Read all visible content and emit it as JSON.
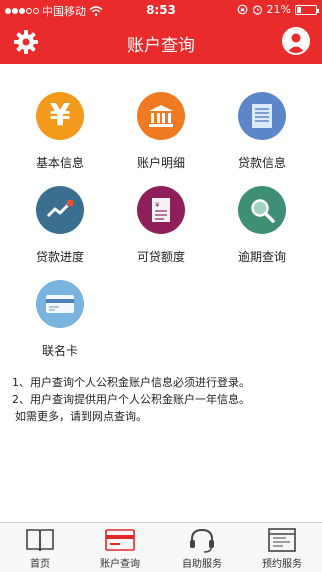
{
  "status_bar": {
    "carrier": "中国移动",
    "time": "8:53",
    "battery": "21%"
  },
  "header": {
    "title": "账户查询",
    "settings_icon": "gear-icon",
    "profile_icon": "user-icon"
  },
  "features": [
    {
      "label": "基本信息",
      "icon": "yen-icon",
      "color": "#f39a1c"
    },
    {
      "label": "账户明细",
      "icon": "bank-icon",
      "color": "#f07a21"
    },
    {
      "label": "贷款信息",
      "icon": "document-icon",
      "color": "#5d86c9"
    },
    {
      "label": "贷款进度",
      "icon": "trend-chart-icon",
      "color": "#3a6f8f"
    },
    {
      "label": "可贷额度",
      "icon": "report-icon",
      "color": "#8e1f5a"
    },
    {
      "label": "逾期查询",
      "icon": "search-icon",
      "color": "#3f8f76"
    },
    {
      "label": "联名卡",
      "icon": "card-icon",
      "color": "#7ab3de"
    }
  ],
  "notes": [
    "1、用户查询个人公积金账户信息必须进行登录。",
    "2、用户查询提供用户个人公积金账户一年信息。",
    "如需更多，请到网点查询。"
  ],
  "bottom_nav": [
    {
      "label": "首页",
      "icon": "book-icon"
    },
    {
      "label": "账户查询",
      "icon": "card-nav-icon",
      "active": true
    },
    {
      "label": "自助服务",
      "icon": "headset-icon"
    },
    {
      "label": "预约服务",
      "icon": "calendar-icon"
    }
  ],
  "colors": {
    "brand_red": "#ea2b2b"
  }
}
